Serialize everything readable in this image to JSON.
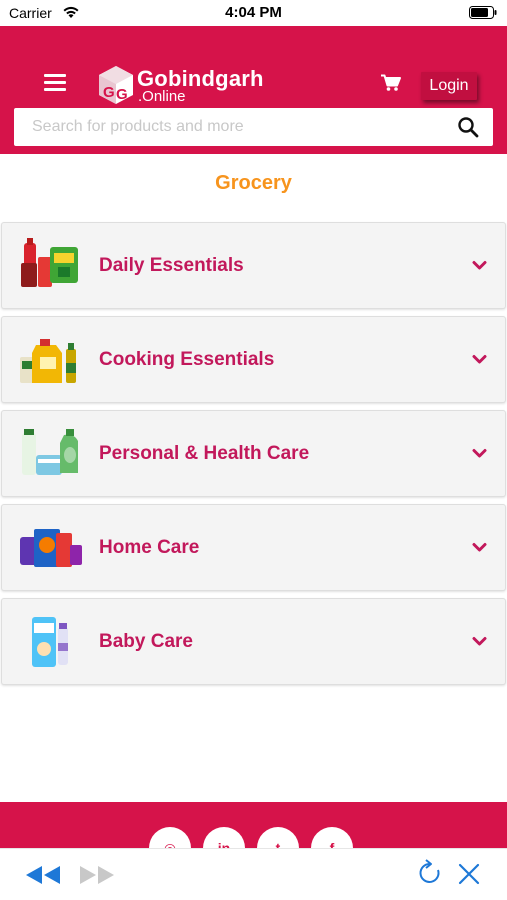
{
  "status_bar": {
    "carrier": "Carrier",
    "time": "4:04 PM"
  },
  "header": {
    "brand_name": "Gobindgarh",
    "brand_sub": ".Online",
    "login_label": "Login",
    "accent_color": "#d6134a"
  },
  "search": {
    "placeholder": "Search for products and more",
    "value": ""
  },
  "page": {
    "title": "Grocery",
    "title_color": "#f7941d"
  },
  "categories": [
    {
      "label": "Daily Essentials"
    },
    {
      "label": "Cooking Essentials"
    },
    {
      "label": "Personal & Health Care"
    },
    {
      "label": "Home Care"
    },
    {
      "label": "Baby Care"
    }
  ],
  "footer": {
    "social_icons": [
      "instagram-icon",
      "linkedin-icon",
      "twitter-icon",
      "facebook-icon"
    ],
    "social_glyphs": [
      "◎",
      "in",
      "t",
      "f"
    ]
  },
  "browser_toolbar": {
    "icons": [
      "back-icon",
      "forward-icon",
      "reload-icon",
      "close-icon"
    ]
  }
}
